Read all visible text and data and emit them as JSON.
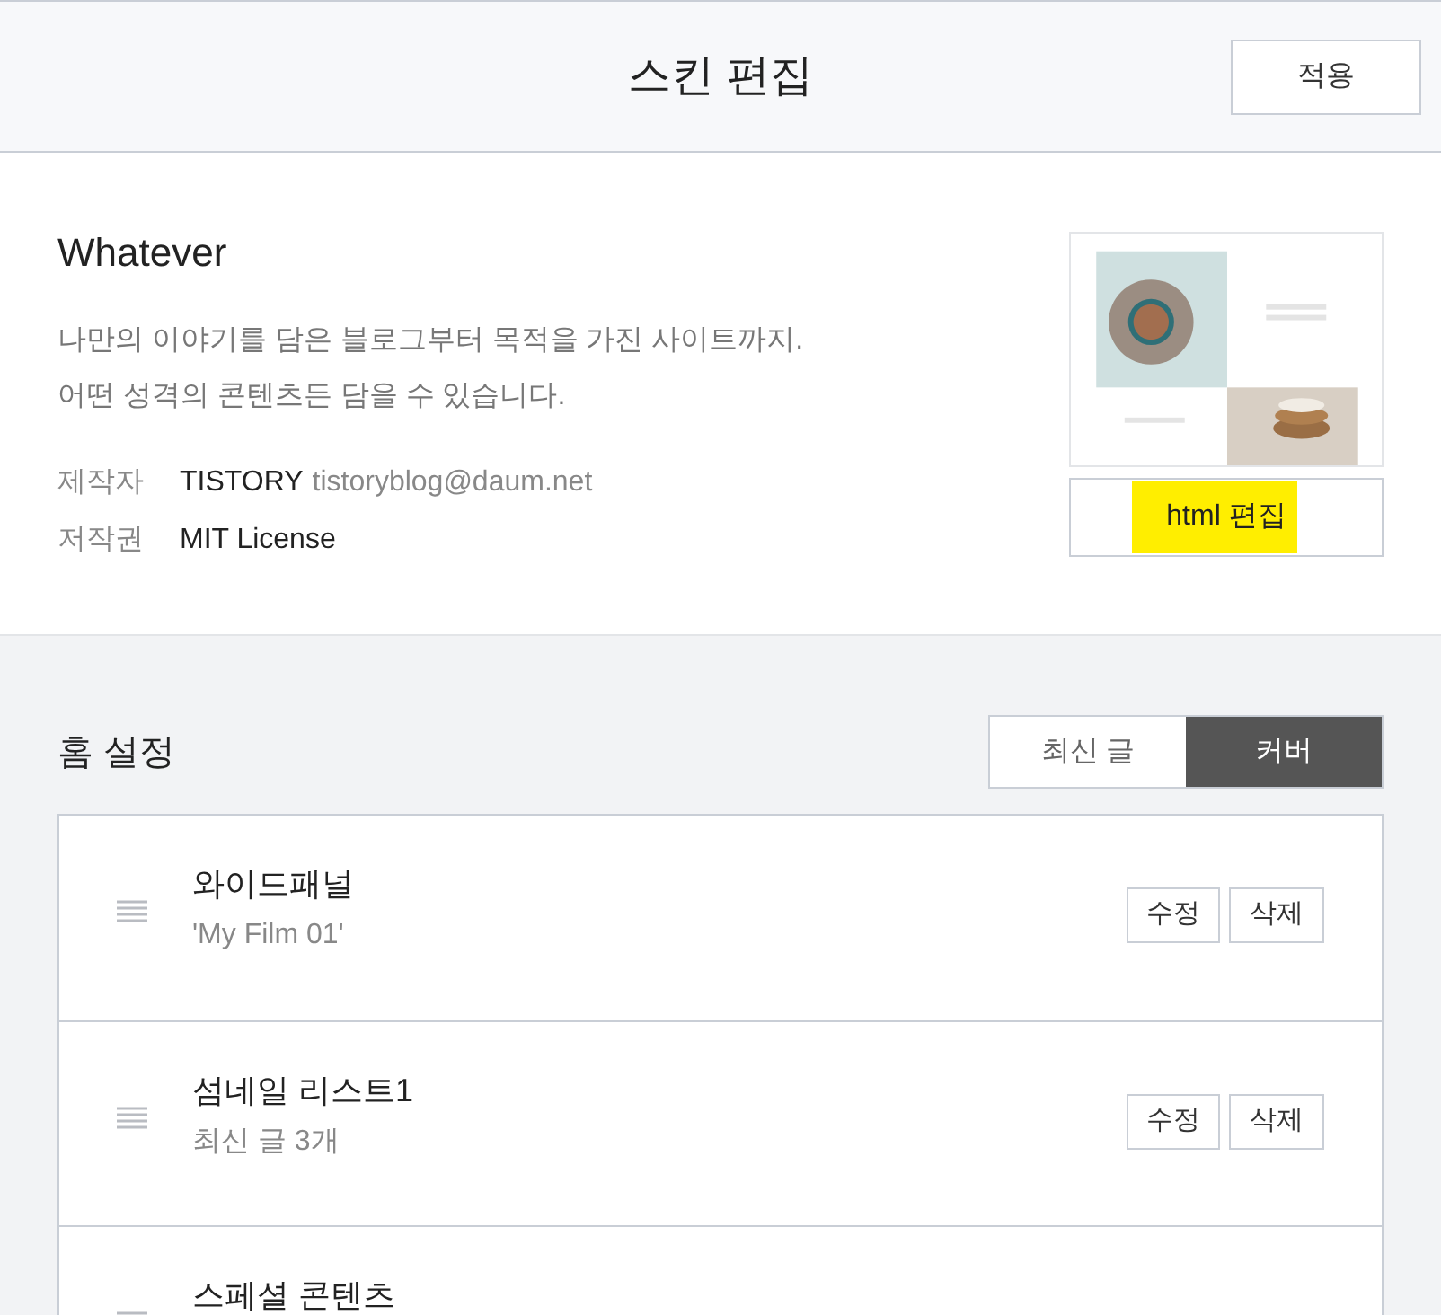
{
  "header": {
    "title": "스킨 편집",
    "apply_button": "적용"
  },
  "skin": {
    "name": "Whatever",
    "description": [
      "나만의 이야기를 담은 블로그부터 목적을 가진 사이트까지.",
      "어떤 성격의 콘텐츠든 담을 수 있습니다."
    ],
    "meta": [
      {
        "label": "제작자",
        "value": "TISTORY",
        "extra": "tistoryblog@daum.net"
      },
      {
        "label": "저작권",
        "value": "MIT License"
      }
    ],
    "preview": {
      "kind": "picture"
    },
    "html_button": {
      "label": "html 편집",
      "highlighted": true
    }
  },
  "home": {
    "title": "홈 설정",
    "tabs": [
      {
        "label": "최신 글",
        "selected": false
      },
      {
        "label": "커버",
        "selected": true
      }
    ],
    "items": [
      {
        "title": "와이드패널",
        "subtitle": "'My Film 01'",
        "edit": "수정",
        "delete": "삭제"
      },
      {
        "title": "섬네일 리스트1",
        "subtitle": "최신 글 3개",
        "edit": "수정",
        "delete": "삭제"
      },
      {
        "title": "스페셜 콘텐츠"
      }
    ]
  }
}
